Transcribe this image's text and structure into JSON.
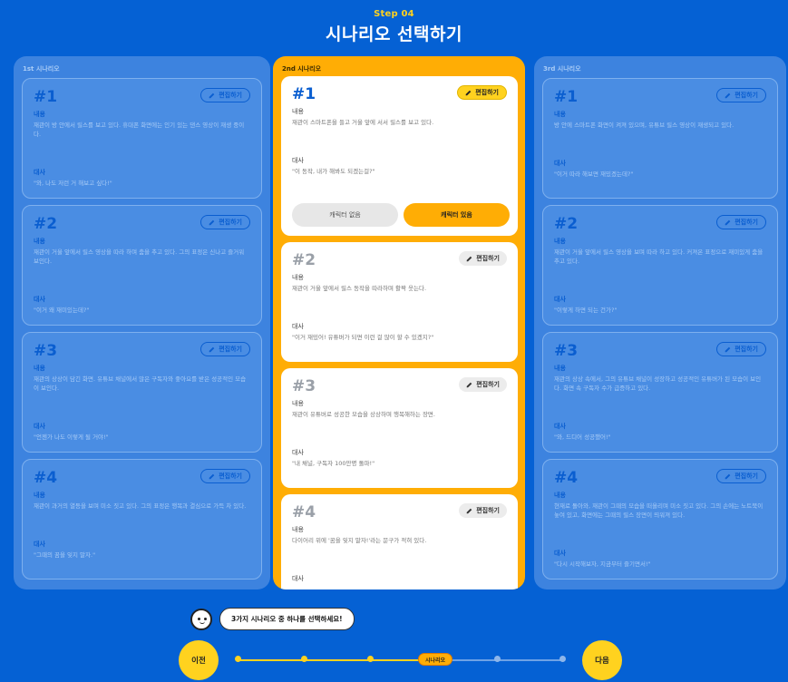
{
  "header": {
    "step": "Step 04",
    "title": "시나리오 선택하기"
  },
  "edit_label": "편집하기",
  "content_label": "내용",
  "line_label": "대사",
  "left": {
    "label": "1st 시나리오",
    "cards": [
      {
        "num": "#1",
        "content": "재관이 방 안에서 릴스를 보고 있다. 휴대폰 화면에는 인기 있는 댄스 영상이 재생 중이다.",
        "line": "\"와, 나도 저런 거 해보고 싶다!\""
      },
      {
        "num": "#2",
        "content": "재관이 거울 앞에서 릴스 영상을 따라 하며 춤을 추고 있다. 그의 표정은 신나고 즐거워 보인다.",
        "line": "\"이거 왜 재미있는데?\""
      },
      {
        "num": "#3",
        "content": "재관의 상상이 담긴 화면. 유튜브 채널에서 많은 구독자와 좋아요를 받은 성공적인 모습이 보인다.",
        "line": "\"언젠가 나도 이렇게 될 거야!\""
      },
      {
        "num": "#4",
        "content": "재관이 과거의 열등을 보며 미소 짓고 있다. 그의 표정은 행복과 결심으로 가득 차 있다.",
        "line": "\"그때의 꿈을 잊지 말자.\""
      }
    ]
  },
  "middle": {
    "label": "2nd 시나리오",
    "cards": [
      {
        "num": "#1",
        "content": "재관이 스마트폰을 들고 거울 앞에 서서 릴스를 보고 있다.",
        "line": "\"이 동작, 내가 해봐도 되겠는걸?\""
      },
      {
        "num": "#2",
        "content": "재관이 거울 앞에서 릴스 동작을 따라하며 활짝 웃는다.",
        "line": "\"이거 재밌어! 유튜버가 되면 이런 걸 많이 할 수 있겠지?\""
      },
      {
        "num": "#3",
        "content": "재관이 유튜버로 성공한 모습을 상상하며 행복해하는 장면.",
        "line": "\"내 채널, 구독자 100만명 돌파!\""
      },
      {
        "num": "#4",
        "content": "다이어리 위에 '꿈을 잊지 말자!'라는 문구가 적혀 있다.",
        "line": ""
      }
    ],
    "char_off": "캐릭터 없음",
    "char_on": "캐릭터 있음"
  },
  "right": {
    "label": "3rd 시나리오",
    "cards": [
      {
        "num": "#1",
        "content": "방 안에 스마트폰 화면이 켜져 있으며, 유튜브 릴스 영상이 재생되고 있다.",
        "line": "\"이거 따라 해보면 재밌겠는데?\""
      },
      {
        "num": "#2",
        "content": "재관이 거울 앞에서 릴스 영상을 보며 따라 하고 있다. 커져온 표정으로 재미있게 춤을 추고 있다.",
        "line": "\"이렇게 하면 되는 건가?\""
      },
      {
        "num": "#3",
        "content": "재관의 상상 속에서, 그의 유튜브 채널이 성장하고 성공적인 유튜버가 된 모습이 보인다. 화면 속 구독자 수가 급증하고 있다.",
        "line": "\"와, 드디어 성공했어!\""
      },
      {
        "num": "#4",
        "content": "현재로 돌아와, 재관이 그때의 모습을 떠올리며 미소 짓고 있다. 그의 손에는 노트북이 놓여 있고, 화면에는 그때의 릴스 장면이 띄워져 있다.",
        "line": "\"다시 시작해보자, 지금부터 즐기면서!\""
      }
    ]
  },
  "tooltip": "3가지 시나리오 중 하나를 선택하세요!",
  "nav": {
    "prev": "이전",
    "next": "다음",
    "current": "시나리오"
  },
  "colors": {
    "background": "#0561d4",
    "accent": "#ffd21f",
    "selected": "#ffad05"
  }
}
